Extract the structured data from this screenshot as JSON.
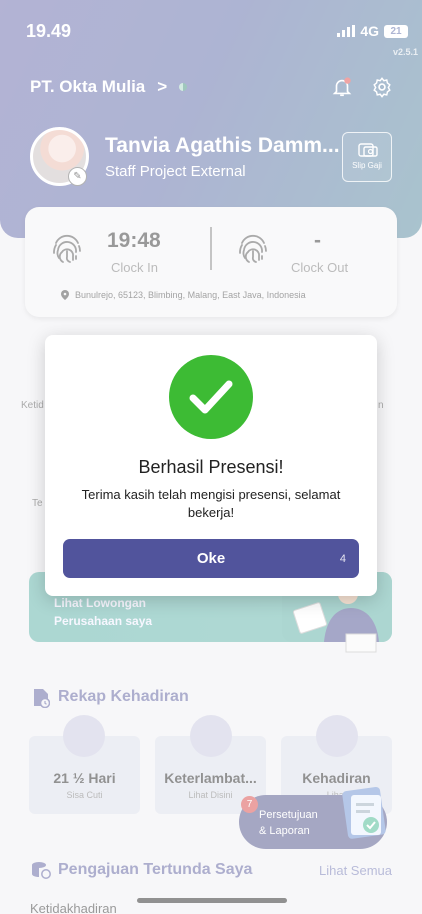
{
  "status_bar": {
    "time": "19.49",
    "network": "4G",
    "battery": "21"
  },
  "version": "v2.5.1",
  "header": {
    "company": "PT. Okta Mulia",
    "chevron": ">"
  },
  "profile": {
    "name": "Tanvia Agathis Damm...",
    "role": "Staff Project External",
    "slip_label": "Slip Gaji"
  },
  "attendance": {
    "clock_in_time": "19:48",
    "clock_in_label": "Clock In",
    "clock_out_time": "-",
    "clock_out_label": "Clock Out",
    "address": "Bunulrejo, 65123, Blimbing, Malang, East Java, Indonesia"
  },
  "menu_partial": {
    "left_label": "Ketid",
    "right_label": "n",
    "left_label_2": "Te"
  },
  "banner": {
    "line1": "Lihat Lowongan",
    "line2": "Perusahaan saya"
  },
  "rekap": {
    "title": "Rekap Kehadiran",
    "items": [
      {
        "value": "21 ½ Hari",
        "sub": "Sisa Cuti"
      },
      {
        "value": "Keterlambat...",
        "sub": "Lihat Disini"
      },
      {
        "value": "Kehadiran",
        "sub": "Lihat"
      }
    ]
  },
  "fab": {
    "badge": "7",
    "line1": "Persetujuan",
    "line2": "& Laporan"
  },
  "pending": {
    "title": "Pengajuan Tertunda Saya",
    "see_all": "Lihat Semua",
    "first_item": "Ketidakhadiran"
  },
  "modal": {
    "title": "Berhasil Presensi!",
    "message": "Terima kasih telah mengisi presensi, selamat bekerja!",
    "button_label": "Oke",
    "countdown": "4"
  },
  "colors": {
    "primary": "#51549c",
    "success": "#3dbb34",
    "teal": "#5fb3a8",
    "badge": "#d64444"
  }
}
